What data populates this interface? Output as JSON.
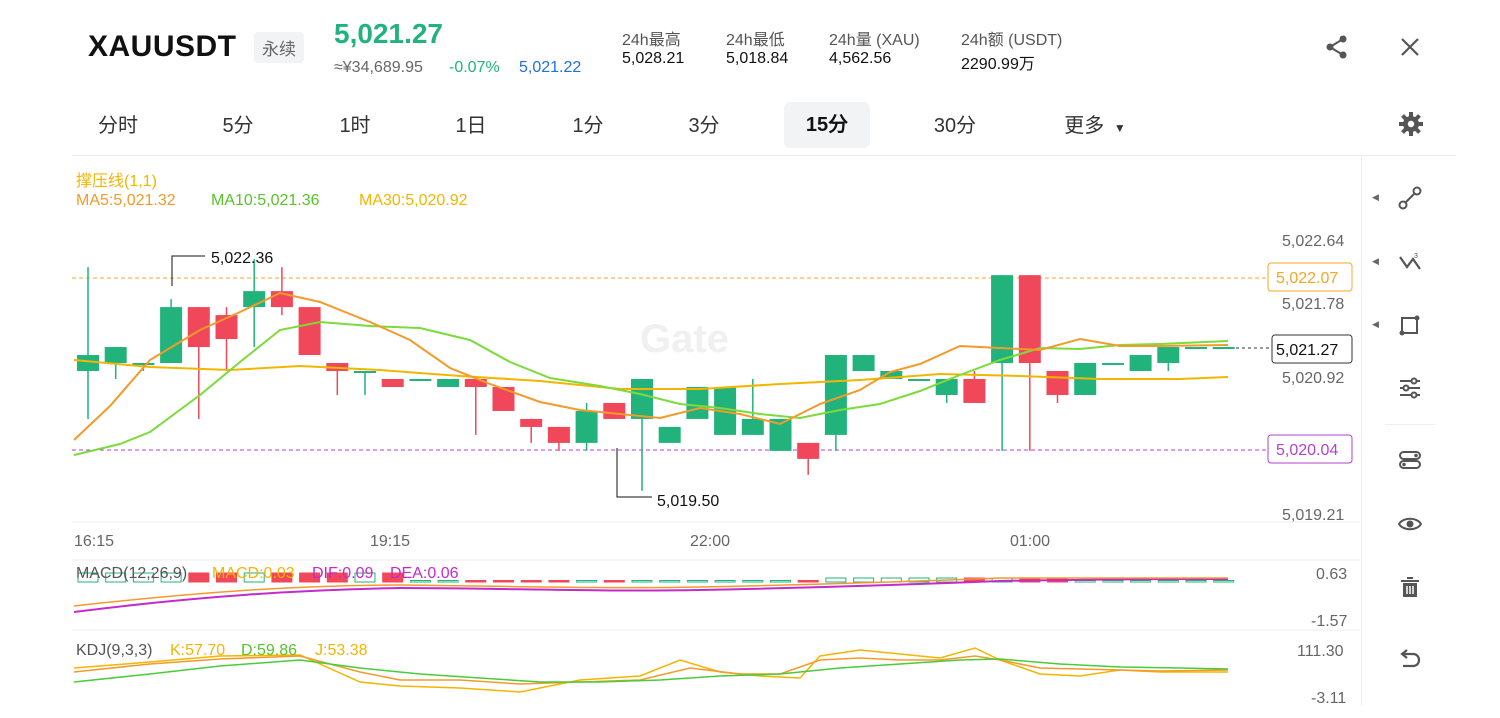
{
  "header": {
    "symbol": "XAUUSDT",
    "contract_type": "永续",
    "last_price": "5,021.27",
    "cny_price": "≈¥34,689.95",
    "change_pct": "-0.07%",
    "mark_price": "5,021.22",
    "stats": [
      {
        "label": "24h最高",
        "value": "5,028.21"
      },
      {
        "label": "24h最低",
        "value": "5,018.84"
      },
      {
        "label": "24h量 (XAU)",
        "value": "4,562.56"
      },
      {
        "label": "24h额 (USDT)",
        "value": "2290.99万"
      }
    ]
  },
  "toolbar": {
    "intervals": [
      "分时",
      "5分",
      "1时",
      "1日",
      "1分",
      "3分",
      "15分",
      "30分"
    ],
    "active_interval": "15分",
    "more_label": "更多"
  },
  "indicators": {
    "sr_label": "撑压线(1,1)",
    "ma5": "MA5:5,021.32",
    "ma10": "MA10:5,021.36",
    "ma30": "MA30:5,020.92",
    "macd_title": "MACD(12,26,9)",
    "macd_val": "MACD:0.03",
    "dif": "DIF:0.09",
    "dea": "DEA:0.06",
    "kdj_title": "KDJ(9,3,3)",
    "k": "K:57.70",
    "d": "D:59.86",
    "j": "J:53.38"
  },
  "chart": {
    "price_axis": [
      "5,022.64",
      "5,021.78",
      "5,020.92",
      "5,019.21"
    ],
    "resistance_tag": "5,022.07",
    "support_tag": "5,020.04",
    "last_tag": "5,021.27",
    "high_mark": "5,022.36",
    "low_mark": "5,019.50",
    "time_axis": [
      "16:15",
      "19:15",
      "22:00",
      "01:00"
    ],
    "macd_axis": [
      "0.63",
      "-1.57"
    ],
    "kdj_axis": [
      "111.30",
      "-3.11"
    ],
    "watermark": "Gate"
  },
  "colors": {
    "up": "#21b37b",
    "down": "#f0475a",
    "ma5": "#f39a2b",
    "ma10": "#7bdb3a",
    "ma30": "#f2b600",
    "support": "#b340d0",
    "accent": "#1e6fe0"
  },
  "chart_data": {
    "type": "candlestick",
    "title": "",
    "ohlc": [
      [
        5021.0,
        5021.2,
        5020.4,
        5022.3
      ],
      [
        5021.1,
        5021.3,
        5020.9,
        5021.3
      ],
      [
        5021.1,
        5021.1,
        5021.0,
        5021.1
      ],
      [
        5021.1,
        5021.8,
        5021.1,
        5021.9
      ],
      [
        5021.8,
        5021.3,
        5020.4,
        5021.8
      ],
      [
        5021.7,
        5021.4,
        5021.0,
        5021.8
      ],
      [
        5021.8,
        5022.0,
        5021.3,
        5022.4
      ],
      [
        5022.0,
        5021.8,
        5021.7,
        5022.3
      ],
      [
        5021.8,
        5021.2,
        5021.2,
        5021.8
      ],
      [
        5021.1,
        5021.0,
        5020.7,
        5021.1
      ],
      [
        5021.0,
        5021.0,
        5020.7,
        5021.0
      ],
      [
        5020.9,
        5020.8,
        5020.8,
        5020.9
      ],
      [
        5020.9,
        5020.9,
        5020.9,
        5020.9
      ],
      [
        5020.8,
        5020.9,
        5020.8,
        5020.9
      ],
      [
        5020.9,
        5020.8,
        5020.2,
        5020.8
      ],
      [
        5020.8,
        5020.5,
        5020.5,
        5020.8
      ],
      [
        5020.4,
        5020.3,
        5020.1,
        5020.4
      ],
      [
        5020.3,
        5020.1,
        5020.0,
        5020.3
      ],
      [
        5020.1,
        5020.5,
        5020.0,
        5020.6
      ],
      [
        5020.6,
        5020.4,
        5020.4,
        5020.6
      ],
      [
        5020.4,
        5020.9,
        5019.5,
        5020.9
      ],
      [
        5020.1,
        5020.3,
        5020.1,
        5020.3
      ],
      [
        5020.4,
        5020.8,
        5020.4,
        5020.8
      ],
      [
        5020.2,
        5020.8,
        5020.2,
        5020.8
      ],
      [
        5020.2,
        5020.4,
        5020.2,
        5020.9
      ],
      [
        5020.0,
        5020.4,
        5020.0,
        5020.4
      ],
      [
        5020.1,
        5019.9,
        5019.7,
        5020.1
      ],
      [
        5020.2,
        5021.2,
        5020.0,
        5021.2
      ],
      [
        5021.0,
        5021.2,
        5021.0,
        5021.2
      ],
      [
        5020.9,
        5021.0,
        5020.9,
        5021.0
      ],
      [
        5020.9,
        5020.9,
        5020.9,
        5020.9
      ],
      [
        5020.7,
        5020.9,
        5020.6,
        5020.9
      ],
      [
        5020.9,
        5020.6,
        5020.6,
        5021.0
      ],
      [
        5021.1,
        5022.2,
        5020.0,
        5022.2
      ],
      [
        5022.2,
        5021.1,
        5020.0,
        5022.2
      ],
      [
        5021.0,
        5020.7,
        5020.6,
        5021.0
      ],
      [
        5020.7,
        5021.1,
        5020.7,
        5021.1
      ],
      [
        5021.1,
        5021.1,
        5021.1,
        5021.1
      ],
      [
        5021.0,
        5021.2,
        5021.0,
        5021.2
      ],
      [
        5021.1,
        5021.3,
        5021.0,
        5021.3
      ],
      [
        5021.3,
        5021.3,
        5021.3,
        5021.3
      ],
      [
        5021.3,
        5021.3,
        5021.3,
        5021.3
      ]
    ],
    "ohlc_order": "open, close, low, high",
    "ylim": [
      5019.21,
      5022.64
    ]
  }
}
